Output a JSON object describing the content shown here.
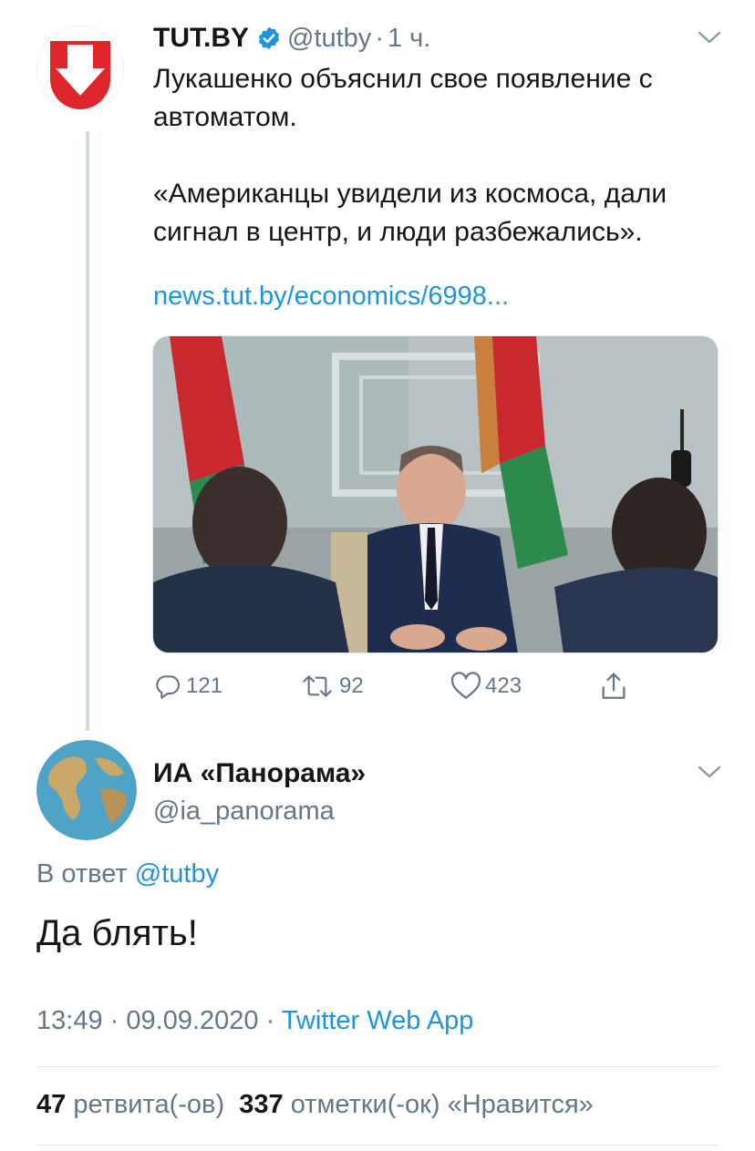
{
  "tweet": {
    "author_name": "TUT.BY",
    "handle": "@tutby",
    "separator": "·",
    "time_ago": "1 ч.",
    "text_line1": "Лукашенко объяснил свое появление с",
    "text_line2": "автоматом.",
    "text_line3": "«Американцы увидели из космоса, дали",
    "text_line4": "сигнал в центр, и люди разбежались».",
    "link": "news.tut.by/economics/6998...",
    "actions": {
      "reply_count": "121",
      "retweet_count": "92",
      "like_count": "423"
    }
  },
  "reply": {
    "author_name": "ИА «Панорама»",
    "handle": "@ia_panorama",
    "replying_prefix": "В ответ",
    "replying_to": "@tutby",
    "text": "Да блять!",
    "time": "13:49",
    "meta_sep1": "·",
    "date": "09.09.2020",
    "meta_sep2": "·",
    "app": "Twitter Web App",
    "retweets_num": "47",
    "retweets_label": "ретвита(-ов)",
    "likes_num": "337",
    "likes_label": "отметки(-ок) «Нравится»"
  },
  "colors": {
    "accent": "#1b95e0",
    "muted": "#657786",
    "text": "#14171a",
    "tutby_red": "#e0262d"
  },
  "icons": {
    "verified": "verified-badge-icon",
    "reply": "reply-icon",
    "retweet": "retweet-icon",
    "like": "heart-icon",
    "share": "share-icon",
    "more": "chevron-down-icon"
  }
}
